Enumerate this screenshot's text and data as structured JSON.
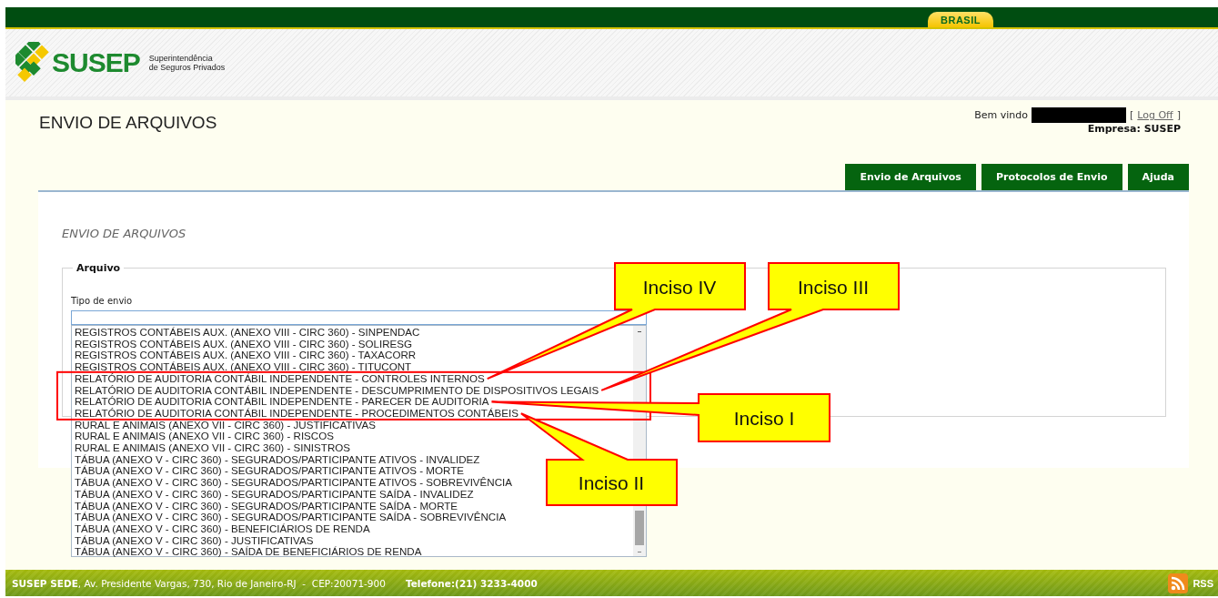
{
  "gov_bar": {
    "brand_tab": "BRASIL"
  },
  "header": {
    "logo_text": "SUSEP",
    "logo_subtitle": [
      "Superintendência",
      "de Seguros Privados"
    ]
  },
  "page_title": "ENVIO DE ARQUIVOS",
  "user_box": {
    "welcome": "Bem vindo",
    "bracket_open": "[",
    "log_off": "Log Off",
    "bracket_close": "]",
    "company": "Empresa: SUSEP"
  },
  "nav_tabs": [
    {
      "label": "Envio de Arquivos"
    },
    {
      "label": "Protocolos de Envio"
    },
    {
      "label": "Ajuda"
    }
  ],
  "panel": {
    "subtitle": "ENVIO DE ARQUIVOS",
    "fieldset_legend": "Arquivo",
    "field_label": "Tipo de envio",
    "options": [
      "REGISTROS CONTÁBEIS AUX. (ANEXO VIII - CIRC 360) - SINPENDAC",
      "REGISTROS CONTÁBEIS AUX. (ANEXO VIII - CIRC 360) - SOLIRESG",
      "REGISTROS CONTÁBEIS AUX. (ANEXO VIII - CIRC 360) - TAXACORR",
      "REGISTROS CONTÁBEIS AUX. (ANEXO VIII - CIRC 360) - TITUCONT",
      "RELATÓRIO DE AUDITORIA CONTÁBIL INDEPENDENTE - CONTROLES INTERNOS",
      "RELATÓRIO DE AUDITORIA CONTÁBIL INDEPENDENTE - DESCUMPRIMENTO DE DISPOSITIVOS LEGAIS",
      "RELATÓRIO DE AUDITORIA CONTÁBIL INDEPENDENTE - PARECER DE AUDITORIA",
      "RELATÓRIO DE AUDITORIA CONTÁBIL INDEPENDENTE - PROCEDIMENTOS CONTÁBEIS",
      "RURAL E ANIMAIS (ANEXO VII - CIRC 360) - JUSTIFICATIVAS",
      "RURAL E ANIMAIS (ANEXO VII - CIRC 360) - RISCOS",
      "RURAL E ANIMAIS (ANEXO VII - CIRC 360) - SINISTROS",
      "TÁBUA (ANEXO V - CIRC 360) - SEGURADOS/PARTICIPANTE ATIVOS - INVALIDEZ",
      "TÁBUA (ANEXO V - CIRC 360) - SEGURADOS/PARTICIPANTE ATIVOS - MORTE",
      "TÁBUA (ANEXO V - CIRC 360) - SEGURADOS/PARTICIPANTE ATIVOS - SOBREVIVÊNCIA",
      "TÁBUA (ANEXO V - CIRC 360) - SEGURADOS/PARTICIPANTE SAÍDA - INVALIDEZ",
      "TÁBUA (ANEXO V - CIRC 360) - SEGURADOS/PARTICIPANTE SAÍDA - MORTE",
      "TÁBUA (ANEXO V - CIRC 360) - SEGURADOS/PARTICIPANTE SAÍDA - SOBREVIVÊNCIA",
      "TÁBUA (ANEXO V - CIRC 360) - BENEFICIÁRIOS DE RENDA",
      "TÁBUA (ANEXO V - CIRC 360) - JUSTIFICATIVAS",
      "TÁBUA (ANEXO V - CIRC 360) - SAÍDA DE BENEFICIÁRIOS DE RENDA"
    ]
  },
  "annotations": [
    {
      "label": "Inciso IV"
    },
    {
      "label": "Inciso III"
    },
    {
      "label": "Inciso I"
    },
    {
      "label": "Inciso II"
    }
  ],
  "footer": {
    "address": "**SUSEP SEDE**, Av. Presidente Vargas, 730, Rio de Janeiro-RJ  -  CEP:20071-900",
    "phone": "Telefone:(21) 3233-4000",
    "rss": "RSS"
  }
}
